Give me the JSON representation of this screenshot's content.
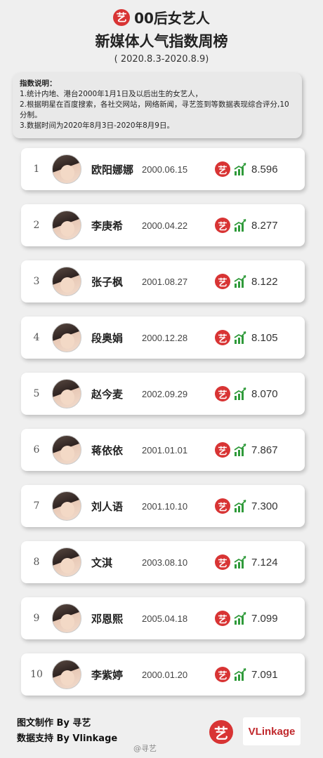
{
  "header": {
    "badge": "艺",
    "title_line1": "00后女艺人",
    "title_line2": "新媒体人气指数周榜",
    "date_range": "( 2020.8.3-2020.8.9)"
  },
  "explain": {
    "title": "指数说明：",
    "lines": [
      "1.统计内地、港台2000年1月1日及以后出生的女艺人，",
      "2.根据明星在百度搜索，各社交网站，网络新闻，寻艺签到等数据表现综合评分,10分制。",
      "3.数据时间为2020年8月3日-2020年8月9日。"
    ]
  },
  "brand_badge": "艺",
  "rankings": [
    {
      "rank": "1",
      "name": "欧阳娜娜",
      "birth": "2000.06.15",
      "score": "8.596"
    },
    {
      "rank": "2",
      "name": "李庚希",
      "birth": "2000.04.22",
      "score": "8.277"
    },
    {
      "rank": "3",
      "name": "张子枫",
      "birth": "2001.08.27",
      "score": "8.122"
    },
    {
      "rank": "4",
      "name": "段奥娟",
      "birth": "2000.12.28",
      "score": "8.105"
    },
    {
      "rank": "5",
      "name": "赵今麦",
      "birth": "2002.09.29",
      "score": "8.070"
    },
    {
      "rank": "6",
      "name": "蒋依依",
      "birth": "2001.01.01",
      "score": "7.867"
    },
    {
      "rank": "7",
      "name": "刘人语",
      "birth": "2001.10.10",
      "score": "7.300"
    },
    {
      "rank": "8",
      "name": "文淇",
      "birth": "2003.08.10",
      "score": "7.124"
    },
    {
      "rank": "9",
      "name": "邓恩熙",
      "birth": "2005.04.18",
      "score": "7.099"
    },
    {
      "rank": "10",
      "name": "李紫婷",
      "birth": "2000.01.20",
      "score": "7.091"
    }
  ],
  "footer": {
    "credit_line1": "图文制作 By 寻艺",
    "credit_line2": "数据支持 By Vlinkage",
    "weibo": "@寻艺",
    "yi_logo": "艺",
    "vlinkage_logo": "VLinkage"
  },
  "colors": {
    "brand_red": "#d83434",
    "trend_green": "#2f9a3a"
  }
}
